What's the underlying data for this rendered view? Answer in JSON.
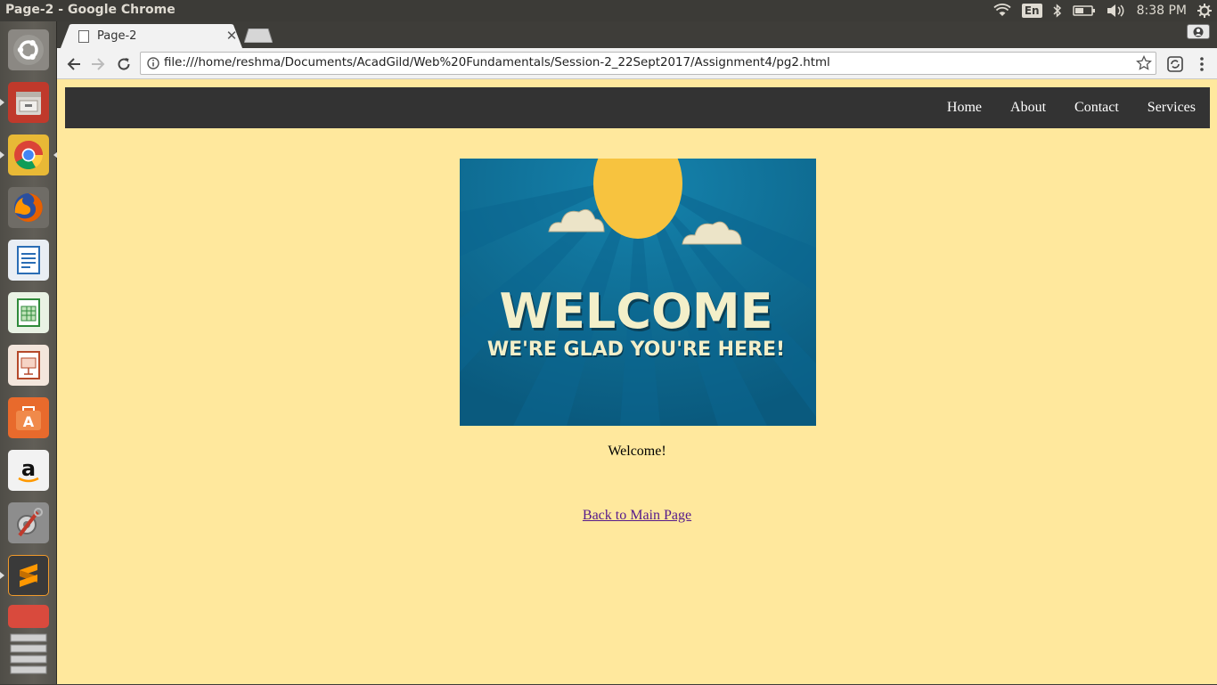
{
  "os": {
    "window_title": "Page-2 - Google Chrome",
    "keyboard_layout": "En",
    "clock": "8:38 PM"
  },
  "launcher": {
    "items": [
      {
        "name": "Dash",
        "icon": "ubuntu-logo-icon"
      },
      {
        "name": "Files",
        "icon": "file-cabinet-icon"
      },
      {
        "name": "Google Chrome",
        "icon": "chrome-icon"
      },
      {
        "name": "Firefox",
        "icon": "firefox-icon"
      },
      {
        "name": "LibreOffice Writer",
        "icon": "writer-icon"
      },
      {
        "name": "LibreOffice Calc",
        "icon": "calc-icon"
      },
      {
        "name": "LibreOffice Impress",
        "icon": "impress-icon"
      },
      {
        "name": "Ubuntu Software",
        "icon": "software-center-icon"
      },
      {
        "name": "Amazon",
        "icon": "amazon-icon"
      },
      {
        "name": "System Settings",
        "icon": "settings-tools-icon"
      },
      {
        "name": "Sublime Text",
        "icon": "sublime-icon"
      },
      {
        "name": "Text Editor",
        "icon": "text-editor-icon"
      },
      {
        "name": "Trash",
        "icon": "trash-icon"
      }
    ]
  },
  "browser": {
    "tab": {
      "title": "Page-2"
    },
    "address_bar": {
      "url": "file:///home/reshma/Documents/AcadGild/Web%20Fundamentals/Session-2_22Sept2017/Assignment4/pg2.html"
    }
  },
  "page": {
    "nav": {
      "items": [
        "Home",
        "About",
        "Contact",
        "Services"
      ]
    },
    "image": {
      "headline": "WELCOME",
      "subline": "WE'RE GLAD YOU'RE HERE!"
    },
    "caption": "Welcome!",
    "back_link": "Back to Main Page"
  },
  "colors": {
    "page_background": "#ffe89d",
    "nav_background": "#333333",
    "link_visited": "#551a8b",
    "image_blue": "#0e6f96",
    "sun_yellow": "#f7c33f"
  }
}
